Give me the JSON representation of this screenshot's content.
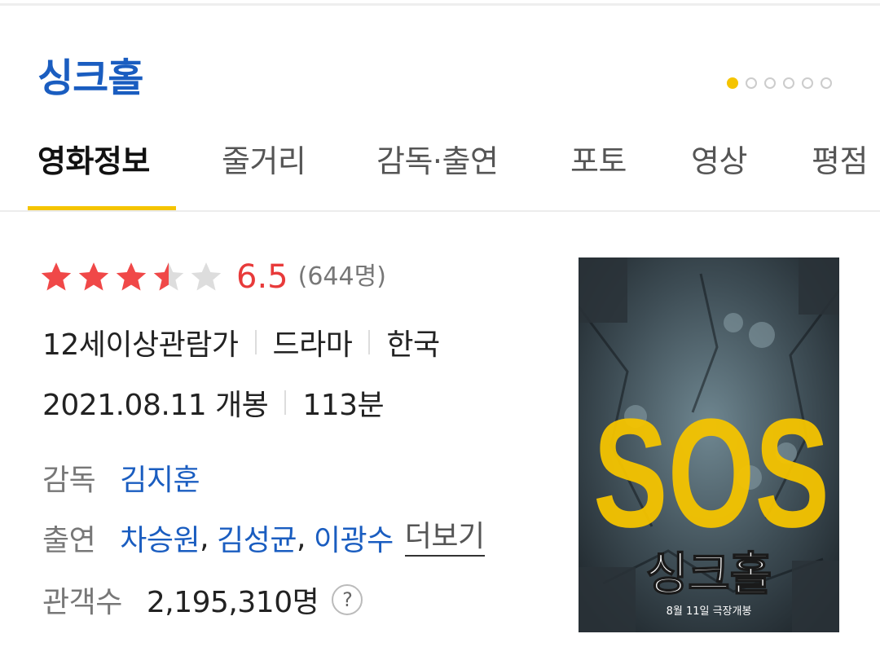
{
  "movie": {
    "title": "싱크홀"
  },
  "carousel": {
    "total": 6,
    "active_index": 0,
    "active_color": "#f5c400"
  },
  "tabs": [
    {
      "label": "영화정보"
    },
    {
      "label": "줄거리"
    },
    {
      "label": "감독·출연"
    },
    {
      "label": "포토"
    },
    {
      "label": "영상"
    },
    {
      "label": "평점"
    }
  ],
  "rating": {
    "stars_filled": 3.5,
    "stars_total": 5,
    "score": "6.5",
    "count": "(644명)",
    "color": "#e83a3a"
  },
  "info": {
    "age": "12세이상관람가",
    "genre": "드라마",
    "country": "한국",
    "release": "2021.08.11 개봉",
    "runtime": "113분"
  },
  "credits": {
    "director_label": "감독",
    "director": "김지훈",
    "cast_label": "출연",
    "cast": [
      "차승원",
      "김성균",
      "이광수"
    ],
    "comma": ",",
    "more_label": "더보기",
    "audience_label": "관객수",
    "audience": "2,195,310명",
    "help_label": "?"
  },
  "poster": {
    "title_text": "싱크홀",
    "sos_text": "SOS",
    "release_caption": "8월 11일 극장개봉",
    "accent": "#f5c400"
  },
  "colors": {
    "brand_blue": "#1a5dc0",
    "accent_yellow": "#f5c400"
  }
}
